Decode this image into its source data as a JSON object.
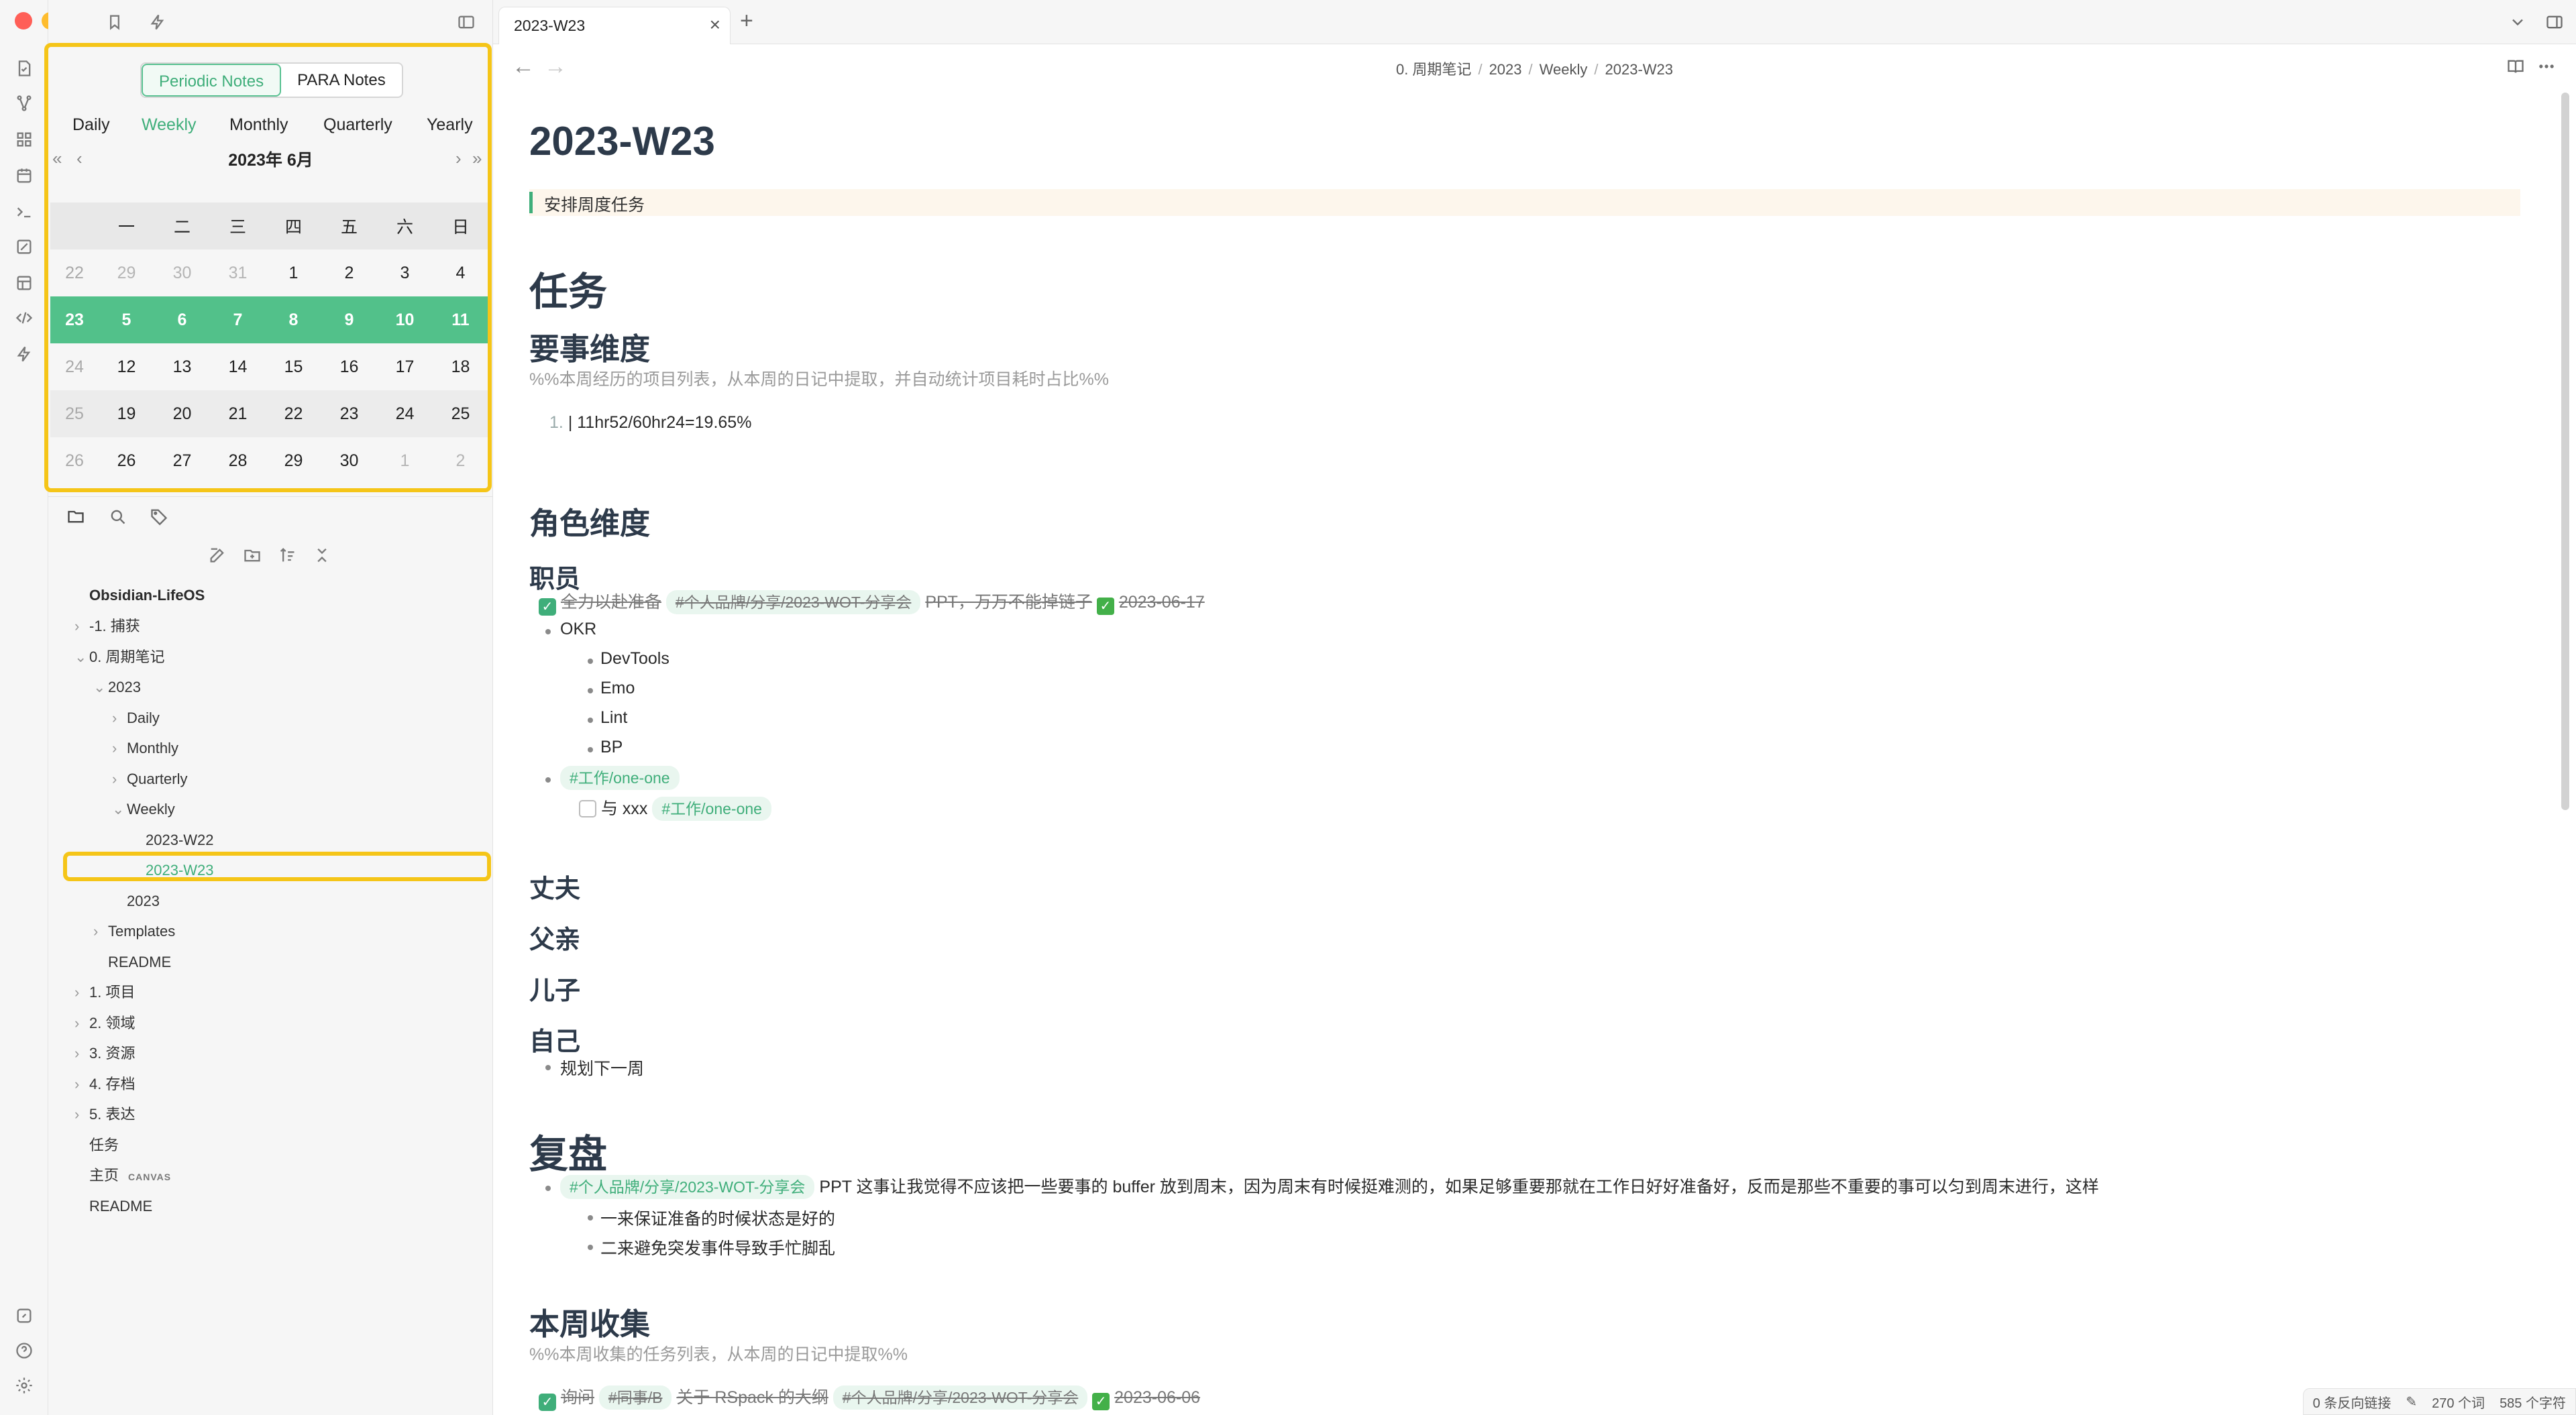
{
  "window": {
    "traffic_colors": [
      "#ff5f57",
      "#febc2e",
      "#28c840"
    ]
  },
  "calendar": {
    "tabs": [
      "Periodic Notes",
      "PARA Notes"
    ],
    "active_tab": "Periodic Notes",
    "granularity": [
      "Daily",
      "Weekly",
      "Monthly",
      "Quarterly",
      "Yearly"
    ],
    "active_granularity": "Weekly",
    "nav": {
      "prev_year": "«",
      "prev_month": "‹",
      "next_month": "›",
      "next_year": "»"
    },
    "month_title": "2023年  6月",
    "weekdays": [
      "一",
      "二",
      "三",
      "四",
      "五",
      "六",
      "日"
    ],
    "weeks": [
      {
        "week": "22",
        "days": [
          "29",
          "30",
          "31",
          "1",
          "2",
          "3",
          "4"
        ],
        "dim": [
          true,
          true,
          true,
          false,
          false,
          false,
          false
        ]
      },
      {
        "week": "23",
        "days": [
          "5",
          "6",
          "7",
          "8",
          "9",
          "10",
          "11"
        ],
        "dim": [
          false,
          false,
          false,
          false,
          false,
          false,
          false
        ],
        "selected": true
      },
      {
        "week": "24",
        "days": [
          "12",
          "13",
          "14",
          "15",
          "16",
          "17",
          "18"
        ],
        "dim": [
          false,
          false,
          false,
          false,
          false,
          false,
          false
        ]
      },
      {
        "week": "25",
        "days": [
          "19",
          "20",
          "21",
          "22",
          "23",
          "24",
          "25"
        ],
        "dim": [
          false,
          false,
          false,
          false,
          false,
          false,
          false
        ]
      },
      {
        "week": "26",
        "days": [
          "26",
          "27",
          "28",
          "29",
          "30",
          "1",
          "2"
        ],
        "dim": [
          false,
          false,
          false,
          false,
          false,
          true,
          true
        ]
      }
    ]
  },
  "file_tree": {
    "vault": "Obsidian-LifeOS",
    "items": [
      {
        "label": "-1. 捕获",
        "depth": 0,
        "chevron": "›"
      },
      {
        "label": "0. 周期笔记",
        "depth": 0,
        "chevron": "⌄"
      },
      {
        "label": "2023",
        "depth": 1,
        "chevron": "⌄"
      },
      {
        "label": "Daily",
        "depth": 2,
        "chevron": "›"
      },
      {
        "label": "Monthly",
        "depth": 2,
        "chevron": "›"
      },
      {
        "label": "Quarterly",
        "depth": 2,
        "chevron": "›"
      },
      {
        "label": "Weekly",
        "depth": 2,
        "chevron": "⌄"
      },
      {
        "label": "2023-W22",
        "depth": 3,
        "chevron": ""
      },
      {
        "label": "2023-W23",
        "depth": 3,
        "chevron": "",
        "active": true
      },
      {
        "label": "2023",
        "depth": 2,
        "chevron": ""
      },
      {
        "label": "Templates",
        "depth": 1,
        "chevron": "›"
      },
      {
        "label": "README",
        "depth": 1,
        "chevron": ""
      },
      {
        "label": "1. 项目",
        "depth": 0,
        "chevron": "›"
      },
      {
        "label": "2. 领域",
        "depth": 0,
        "chevron": "›"
      },
      {
        "label": "3. 资源",
        "depth": 0,
        "chevron": "›"
      },
      {
        "label": "4. 存档",
        "depth": 0,
        "chevron": "›"
      },
      {
        "label": "5. 表达",
        "depth": 0,
        "chevron": "›"
      },
      {
        "label": "任务",
        "depth": 0,
        "chevron": ""
      },
      {
        "label": "主页",
        "depth": 0,
        "chevron": "",
        "badge": "CANVAS"
      },
      {
        "label": "README",
        "depth": 0,
        "chevron": ""
      }
    ]
  },
  "tab": {
    "title": "2023-W23",
    "close": "×",
    "add": "+"
  },
  "nav": {
    "back": "←",
    "forward": "→"
  },
  "breadcrumb": [
    "0. 周期笔记",
    "2023",
    "Weekly",
    "2023-W23"
  ],
  "note": {
    "title": "2023-W23",
    "callout": "安排周度任务",
    "h_tasks": "任务",
    "h_key": "要事维度",
    "key_comment": "%%本周经历的项目列表，从本周的日记中提取，并自动统计项目耗时占比%%",
    "key_item_num": "1.",
    "key_item": "| 11hr52/60hr24=19.65%",
    "h_roles": "角色维度",
    "h_staff": "职员",
    "staff_task": {
      "text": "全力以赴准备",
      "tag": "#个人品牌/分享/2023-WOT-分享会",
      "tail": "PPT，万万不能掉链子",
      "date": "2023-06-17"
    },
    "okr": "OKR",
    "okr_items": [
      "DevTools",
      "Emo",
      "Lint",
      "BP"
    ],
    "one_one_tag": "#工作/one-one",
    "one_one_task": "与 xxx",
    "one_one_task_tag": "#工作/one-one",
    "h_husband": "丈夫",
    "h_father": "父亲",
    "h_son": "儿子",
    "h_self": "自己",
    "self_item": "规划下一周",
    "h_review": "复盘",
    "review_tag": "#个人品牌/分享/2023-WOT-分享会",
    "review_text": "PPT 这事让我觉得不应该把一些要事的 buffer 放到周末，因为周末有时候挺难测的，如果足够重要那就在工作日好好准备好，反而是那些不重要的事可以匀到周末进行，这样",
    "review_sub": [
      "一来保证准备的时候状态是好的",
      "二来避免突发事件导致手忙脚乱"
    ],
    "h_collect": "本周收集",
    "collect_comment": "%%本周收集的任务列表，从本周的日记中提取%%",
    "collect_task": {
      "text": "询问",
      "tag1": "#同事/B",
      "mid": "关于 RSpack 的大纲",
      "tag2": "#个人品牌/分享/2023-WOT-分享会",
      "date": "2023-06-06"
    }
  },
  "status": {
    "backlinks": "0 条反向链接",
    "words": "270 个词",
    "chars": "585 个字符"
  },
  "colors": {
    "accent": "#3fae7a",
    "highlight_box": "#f5c518",
    "selected_week": "#52c18a"
  }
}
